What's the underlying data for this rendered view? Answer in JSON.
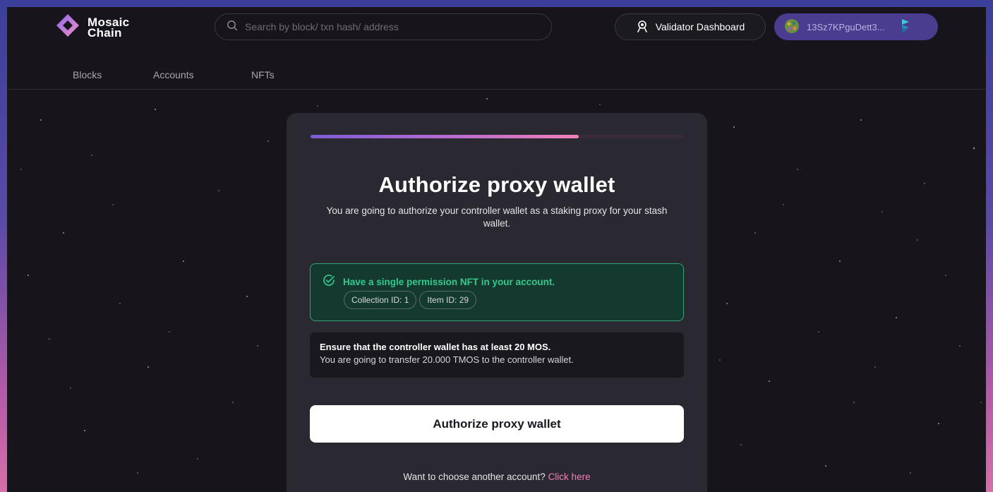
{
  "header": {
    "logo_line1": "Mosaic",
    "logo_line2": "Chain",
    "search_placeholder": "Search by block/ txn hash/ address",
    "validator_label": "Validator Dashboard",
    "account_label": "13Sz7KPguDett3..."
  },
  "nav": {
    "items": [
      {
        "label": "Blocks"
      },
      {
        "label": "Accounts"
      },
      {
        "label": "NFTs"
      }
    ]
  },
  "card": {
    "progress_fraction": 0.72,
    "title": "Authorize proxy wallet",
    "subtitle": "You are going to authorize your controller wallet as a staking proxy for your stash wallet.",
    "permission": {
      "text": "Have a single permission NFT in your account.",
      "collection_chip": "Collection ID: 1",
      "item_chip": "Item ID: 29"
    },
    "info": {
      "line1": "Ensure that the controller wallet has at least 20 MOS.",
      "line2": "You are going to transfer 20.000 TMOS to the controller wallet."
    },
    "button_label": "Authorize proxy wallet",
    "another_prompt": "Want to choose another account?",
    "another_link": "Click here"
  },
  "colors": {
    "background": "#17151b",
    "card": "#2a2830",
    "accent_pink": "#f07fb8",
    "accent_purple": "#7d5bd6",
    "success_green": "#35c98d",
    "account_pill": "#4a3c8e"
  },
  "icons": {
    "logo": "mosaic-diamond-icon",
    "search": "search-icon",
    "validator": "validator-person-icon",
    "account_avatar": "account-avatar-icon",
    "account_badge": "polkadot-badge-icon",
    "permission_check": "check-circle-icon"
  }
}
